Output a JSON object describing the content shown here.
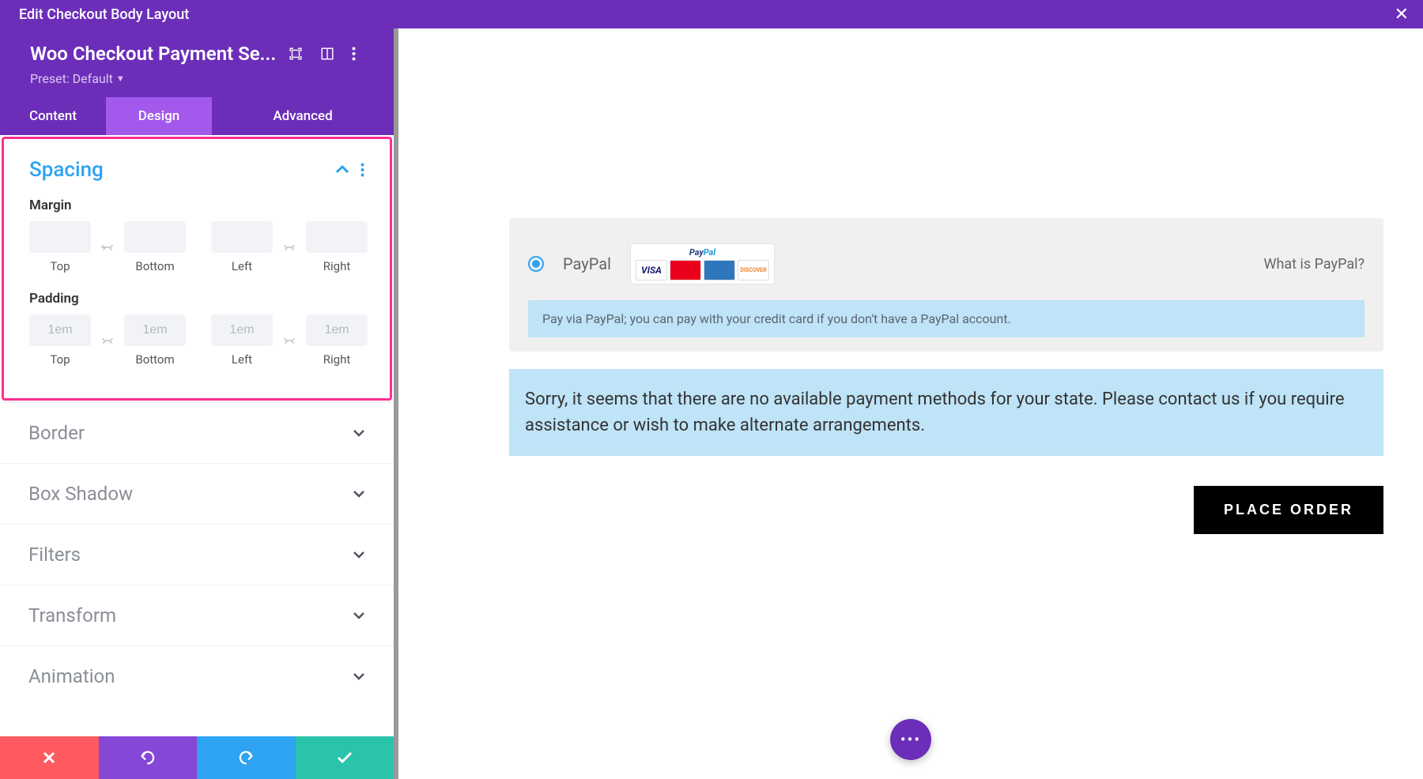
{
  "topbar": {
    "title": "Edit Checkout Body Layout"
  },
  "module": {
    "title": "Woo Checkout Payment Se...",
    "preset_label": "Preset: Default"
  },
  "tabs": {
    "content": "Content",
    "design": "Design",
    "advanced": "Advanced"
  },
  "spacing": {
    "title": "Spacing",
    "margin_label": "Margin",
    "padding_label": "Padding",
    "sides": {
      "top": "Top",
      "bottom": "Bottom",
      "left": "Left",
      "right": "Right"
    },
    "padding_placeholder": "1em"
  },
  "sections": {
    "border": "Border",
    "box_shadow": "Box Shadow",
    "filters": "Filters",
    "transform": "Transform",
    "animation": "Animation"
  },
  "preview": {
    "paypal_label": "PayPal",
    "what_is": "What is PayPal?",
    "paypal_desc": "Pay via PayPal; you can pay with your credit card if you don't have a PayPal account.",
    "error_msg": "Sorry, it seems that there are no available payment methods for your state. Please contact us if you require assistance or wish to make alternate arrangements.",
    "place_order": "PLACE ORDER",
    "cards": {
      "visa": "VISA",
      "mc": "MasterCard",
      "amex": "AMEX",
      "disc": "DISCOVER"
    }
  }
}
